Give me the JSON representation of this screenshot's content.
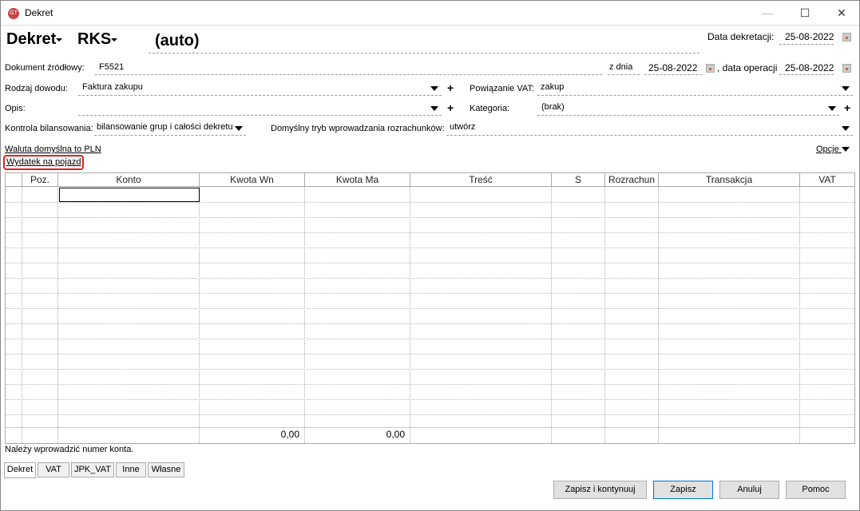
{
  "window": {
    "title": "Dekret",
    "minimize": "—",
    "maximize": "☐",
    "close": "✕"
  },
  "header": {
    "doc_type": "Dekret",
    "journal": "RKS",
    "number": "(auto)",
    "date_label": "Data dekretacji:",
    "date_value": "25-08-2022"
  },
  "form": {
    "source_doc_label": "Dokument źródłowy:",
    "source_doc_value": "F5521",
    "from_day_label": "z dnia",
    "from_day_value": "25-08-2022",
    "op_date_label": ", data operacji",
    "op_date_value": "25-08-2022",
    "proof_type_label": "Rodzaj dowodu:",
    "proof_type_value": "Faktura zakupu",
    "vat_link_label": "Powiązanie VAT:",
    "vat_link_value": "zakup",
    "desc_label": "Opis:",
    "desc_value": "",
    "category_label": "Kategoria:",
    "category_value": "(brak)",
    "balance_label": "Kontrola bilansowania:",
    "balance_value": "bilansowanie grup i całości dekretu",
    "settlement_label": "Domyślny tryb wprowadzania rozrachunków:",
    "settlement_value": "utwórz",
    "currency_link": "Waluta domyślna to PLN",
    "vehicle_link": "Wydatek na pojazd",
    "options": "Opcje",
    "plus": "+"
  },
  "table": {
    "columns": [
      "",
      "Poz.",
      "Konto",
      "Kwota Wn",
      "Kwota Ma",
      "Treść",
      "S",
      "Rozrachun",
      "Transakcja",
      "VAT"
    ],
    "total_wn": "0,00",
    "total_ma": "0,00"
  },
  "status": "Należy wprowadzić numer konta.",
  "tabs": [
    "Dekret",
    "VAT",
    "JPK_VAT",
    "Inne",
    "Własne"
  ],
  "buttons": {
    "save_continue": "Zapisz i kontynuuj",
    "save": "Zapisz",
    "cancel": "Anuluj",
    "help": "Pomoc"
  },
  "colors": {
    "highlight": "#e02020"
  }
}
